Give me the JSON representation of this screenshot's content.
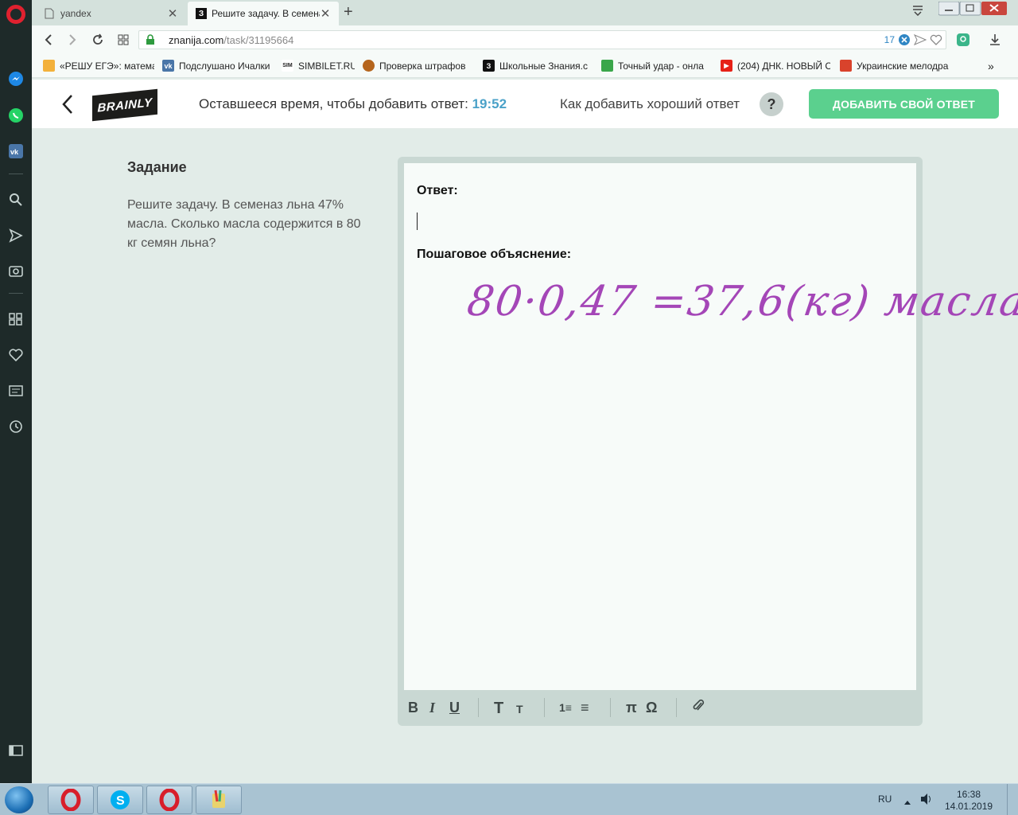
{
  "browser": {
    "tabs": [
      {
        "label": "yandex",
        "icon": "document-icon"
      },
      {
        "label": "Решите задачу. В семена",
        "icon": "znanija-icon"
      }
    ],
    "url": {
      "host": "znanija.com",
      "path": "/task/31195664",
      "count": "17"
    },
    "bookmarks": [
      {
        "label": "«РЕШУ ЕГЭ»: матема",
        "color": "#e07b1a",
        "glyph": "☼"
      },
      {
        "label": "Подслушано Ичалки",
        "color": "#4a76a8",
        "glyph": "vk"
      },
      {
        "label": "SIMBILET.RU",
        "color": "#222222",
        "glyph": "SIM"
      },
      {
        "label": "Проверка штрафов",
        "color": "#b5651d",
        "glyph": "●"
      },
      {
        "label": "Школьные Знания.c",
        "color": "#111111",
        "glyph": "З"
      },
      {
        "label": "Точный удар - онла",
        "color": "#3aa64a",
        "glyph": "✦"
      },
      {
        "label": "(204) ДНК. НОВЫЙ С",
        "color": "#e62117",
        "glyph": "▶"
      },
      {
        "label": "Украинские мелодра",
        "color": "#d9432c",
        "glyph": "A"
      }
    ]
  },
  "header": {
    "logo": "BRAINLY",
    "timer_label": "Оставшееся время, чтобы добавить ответ:",
    "timer_value": "19:52",
    "howto": "Как добавить хороший ответ",
    "help_symbol": "?",
    "add_answer": "ДОБАВИТЬ СВОЙ ОТВЕТ",
    "accent": "#5bd08e"
  },
  "task": {
    "heading": "Задание",
    "text": "Решите задачу. В семеназ льна 47% масла. Сколько масла содержится в 80 кг семян льна?"
  },
  "editor": {
    "answer_label": "Ответ:",
    "explanation_label": "Пошаговое объяснение:",
    "handwriting": "80·0,47 =37,6(кг) масла",
    "toolbar": [
      "B",
      "I",
      "U",
      "T",
      "T",
      "1≡",
      "≡",
      "π",
      "Ω",
      "📎"
    ]
  },
  "taskbar": {
    "lang": "RU",
    "time": "16:38",
    "date": "14.01.2019"
  }
}
